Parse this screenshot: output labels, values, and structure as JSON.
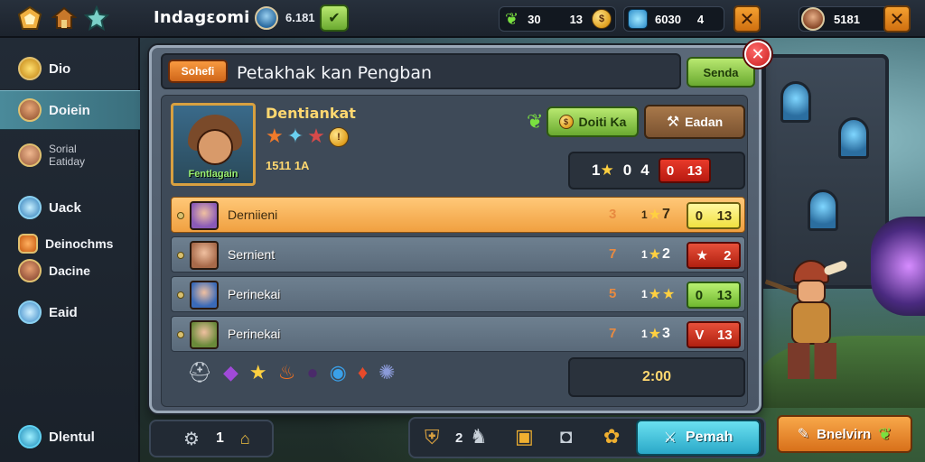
{
  "topbar": {
    "title": "Indagɛomi",
    "player_count": "6.181",
    "gems_left": "30",
    "gems_right": "13",
    "coins": "6030",
    "coins_suffix": "4",
    "player_id": "5181",
    "icons": [
      "home-badge-icon",
      "house-icon",
      "star-icon",
      "globe-avatar-icon",
      "leaf-check-icon",
      "leaf-icon",
      "coin-icon",
      "blue-crystal-icon",
      "close-icon",
      "avatar-icon",
      "close-icon"
    ]
  },
  "sidebar": {
    "items": [
      {
        "label": "Dio",
        "sub": "",
        "icon": "gold-medal-icon"
      },
      {
        "label": "Doiein",
        "sub": "",
        "icon": "hero-avatar-icon"
      },
      {
        "label": "Sorial",
        "sub": "Eatiday",
        "icon": "face-avatar-icon"
      },
      {
        "label": "Uack",
        "sub": "",
        "icon": "blue-swirl-icon"
      },
      {
        "label": "Deinochms",
        "sub": "",
        "icon": "fox-icon"
      },
      {
        "label": "Dacine",
        "sub": "",
        "icon": "warrior-avatar-icon"
      },
      {
        "label": "Eaid",
        "sub": "",
        "icon": "blue-shield-icon"
      }
    ],
    "footer": "Dlentul"
  },
  "panel": {
    "tag": "Sohefi",
    "title": "Petakhak kan Pengban",
    "top_button": "Senda",
    "hero": {
      "portrait_label": "Fentlagain",
      "name": "Dentiankat",
      "number": "1511 1A",
      "stars": [
        "orange-star-icon",
        "blue-star-icon",
        "red-star-icon",
        "gold-coin-icon"
      ]
    },
    "action_green": "Doiti Ka",
    "action_brown": "Eadan",
    "score": {
      "prefix": "1",
      "a": "0",
      "b": "4",
      "chip_a": "0",
      "chip_b": "13"
    },
    "rows": [
      {
        "name": "Derniieni",
        "mark": "3",
        "stars_text": "7",
        "stars": 1,
        "chip_a": "0",
        "chip_b": "13",
        "chip": "yellow",
        "active": true,
        "avatar_color": "#8a5ab8"
      },
      {
        "name": "Sernient",
        "mark": "7",
        "stars_text": "2",
        "stars": 1,
        "chip_a": "★",
        "chip_b": "2",
        "chip": "red",
        "active": false,
        "avatar_color": "#a86a4a"
      },
      {
        "name": "Perinekai",
        "mark": "5",
        "stars_text": "",
        "stars": 2,
        "chip_a": "0",
        "chip_b": "13",
        "chip": "green",
        "active": false,
        "avatar_color": "#3a6ab8"
      },
      {
        "name": "Perinekai",
        "mark": "7",
        "stars_text": "3",
        "stars": 1,
        "chip_a": "V",
        "chip_b": "13",
        "chip": "red",
        "active": false,
        "avatar_color": "#6a8a3a"
      }
    ],
    "items": [
      "helmet-icon",
      "purple-crystal-icon",
      "gold-star-icon",
      "fire-icon",
      "dark-gem-icon",
      "blue-orb-icon",
      "red-gem-icon",
      "rune-icon"
    ],
    "timer": "2:00"
  },
  "bottom": {
    "left_count": "1",
    "mid_count": "2",
    "main_button": "Pemah",
    "right_button": "Bnelvirn"
  }
}
